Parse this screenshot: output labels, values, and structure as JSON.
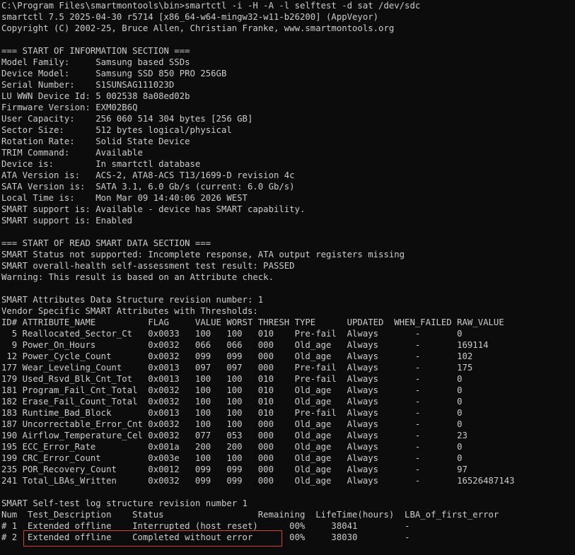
{
  "console": {
    "lines": [
      "C:\\Program Files\\smartmontools\\bin>smartctl -i -H -A -l selftest -d sat /dev/sdc",
      "smartctl 7.5 2025-04-30 r5714 [x86_64-w64-mingw32-w11-b26200] (AppVeyor)",
      "Copyright (C) 2002-25, Bruce Allen, Christian Franke, www.smartmontools.org",
      "",
      "=== START OF INFORMATION SECTION ===",
      "Model Family:     Samsung based SSDs",
      "Device Model:     Samsung SSD 850 PRO 256GB",
      "Serial Number:    S1SUNSAG111023D",
      "LU WWN Device Id: 5 002538 8a08ed02b",
      "Firmware Version: EXM02B6Q",
      "User Capacity:    256 060 514 304 bytes [256 GB]",
      "Sector Size:      512 bytes logical/physical",
      "Rotation Rate:    Solid State Device",
      "TRIM Command:     Available",
      "Device is:        In smartctl database",
      "ATA Version is:   ACS-2, ATA8-ACS T13/1699-D revision 4c",
      "SATA Version is:  SATA 3.1, 6.0 Gb/s (current: 6.0 Gb/s)",
      "Local Time is:    Mon Mar 09 14:40:06 2026 WEST",
      "SMART support is: Available - device has SMART capability.",
      "SMART support is: Enabled",
      "",
      "=== START OF READ SMART DATA SECTION ===",
      "SMART Status not supported: Incomplete response, ATA output registers missing",
      "SMART overall-health self-assessment test result: PASSED",
      "Warning: This result is based on an Attribute check.",
      "",
      "SMART Attributes Data Structure revision number: 1",
      "Vendor Specific SMART Attributes with Thresholds:",
      "ID# ATTRIBUTE_NAME          FLAG     VALUE WORST THRESH TYPE      UPDATED  WHEN_FAILED RAW_VALUE",
      "  5 Reallocated_Sector_Ct   0x0033   100   100   010    Pre-fail  Always       -       0",
      "  9 Power_On_Hours          0x0032   066   066   000    Old_age   Always       -       169114",
      " 12 Power_Cycle_Count       0x0032   099   099   000    Old_age   Always       -       102",
      "177 Wear_Leveling_Count     0x0013   097   097   000    Pre-fail  Always       -       175",
      "179 Used_Rsvd_Blk_Cnt_Tot   0x0013   100   100   010    Pre-fail  Always       -       0",
      "181 Program_Fail_Cnt_Total  0x0032   100   100   010    Old_age   Always       -       0",
      "182 Erase_Fail_Count_Total  0x0032   100   100   010    Old_age   Always       -       0",
      "183 Runtime_Bad_Block       0x0013   100   100   010    Pre-fail  Always       -       0",
      "187 Uncorrectable_Error_Cnt 0x0032   100   100   000    Old_age   Always       -       0",
      "190 Airflow_Temperature_Cel 0x0032   077   053   000    Old_age   Always       -       23",
      "195 ECC_Error_Rate          0x001a   200   200   000    Old_age   Always       -       0",
      "199 CRC_Error_Count         0x003e   100   100   000    Old_age   Always       -       0",
      "235 POR_Recovery_Count      0x0012   099   099   000    Old_age   Always       -       97",
      "241 Total_LBAs_Written      0x0032   099   099   000    Old_age   Always       -       16526487143",
      "",
      "SMART Self-test log structure revision number 1",
      "Num  Test_Description    Status                  Remaining  LifeTime(hours)  LBA_of_first_error",
      "# 1  Extended offline    Interrupted (host reset)      00%     38041         -",
      "# 2  Extended offline    Completed without error       00%     38030         -"
    ]
  },
  "colors": {
    "background": "#0c0c0c",
    "text": "#cccccc",
    "highlight_border": "#d23f31"
  }
}
